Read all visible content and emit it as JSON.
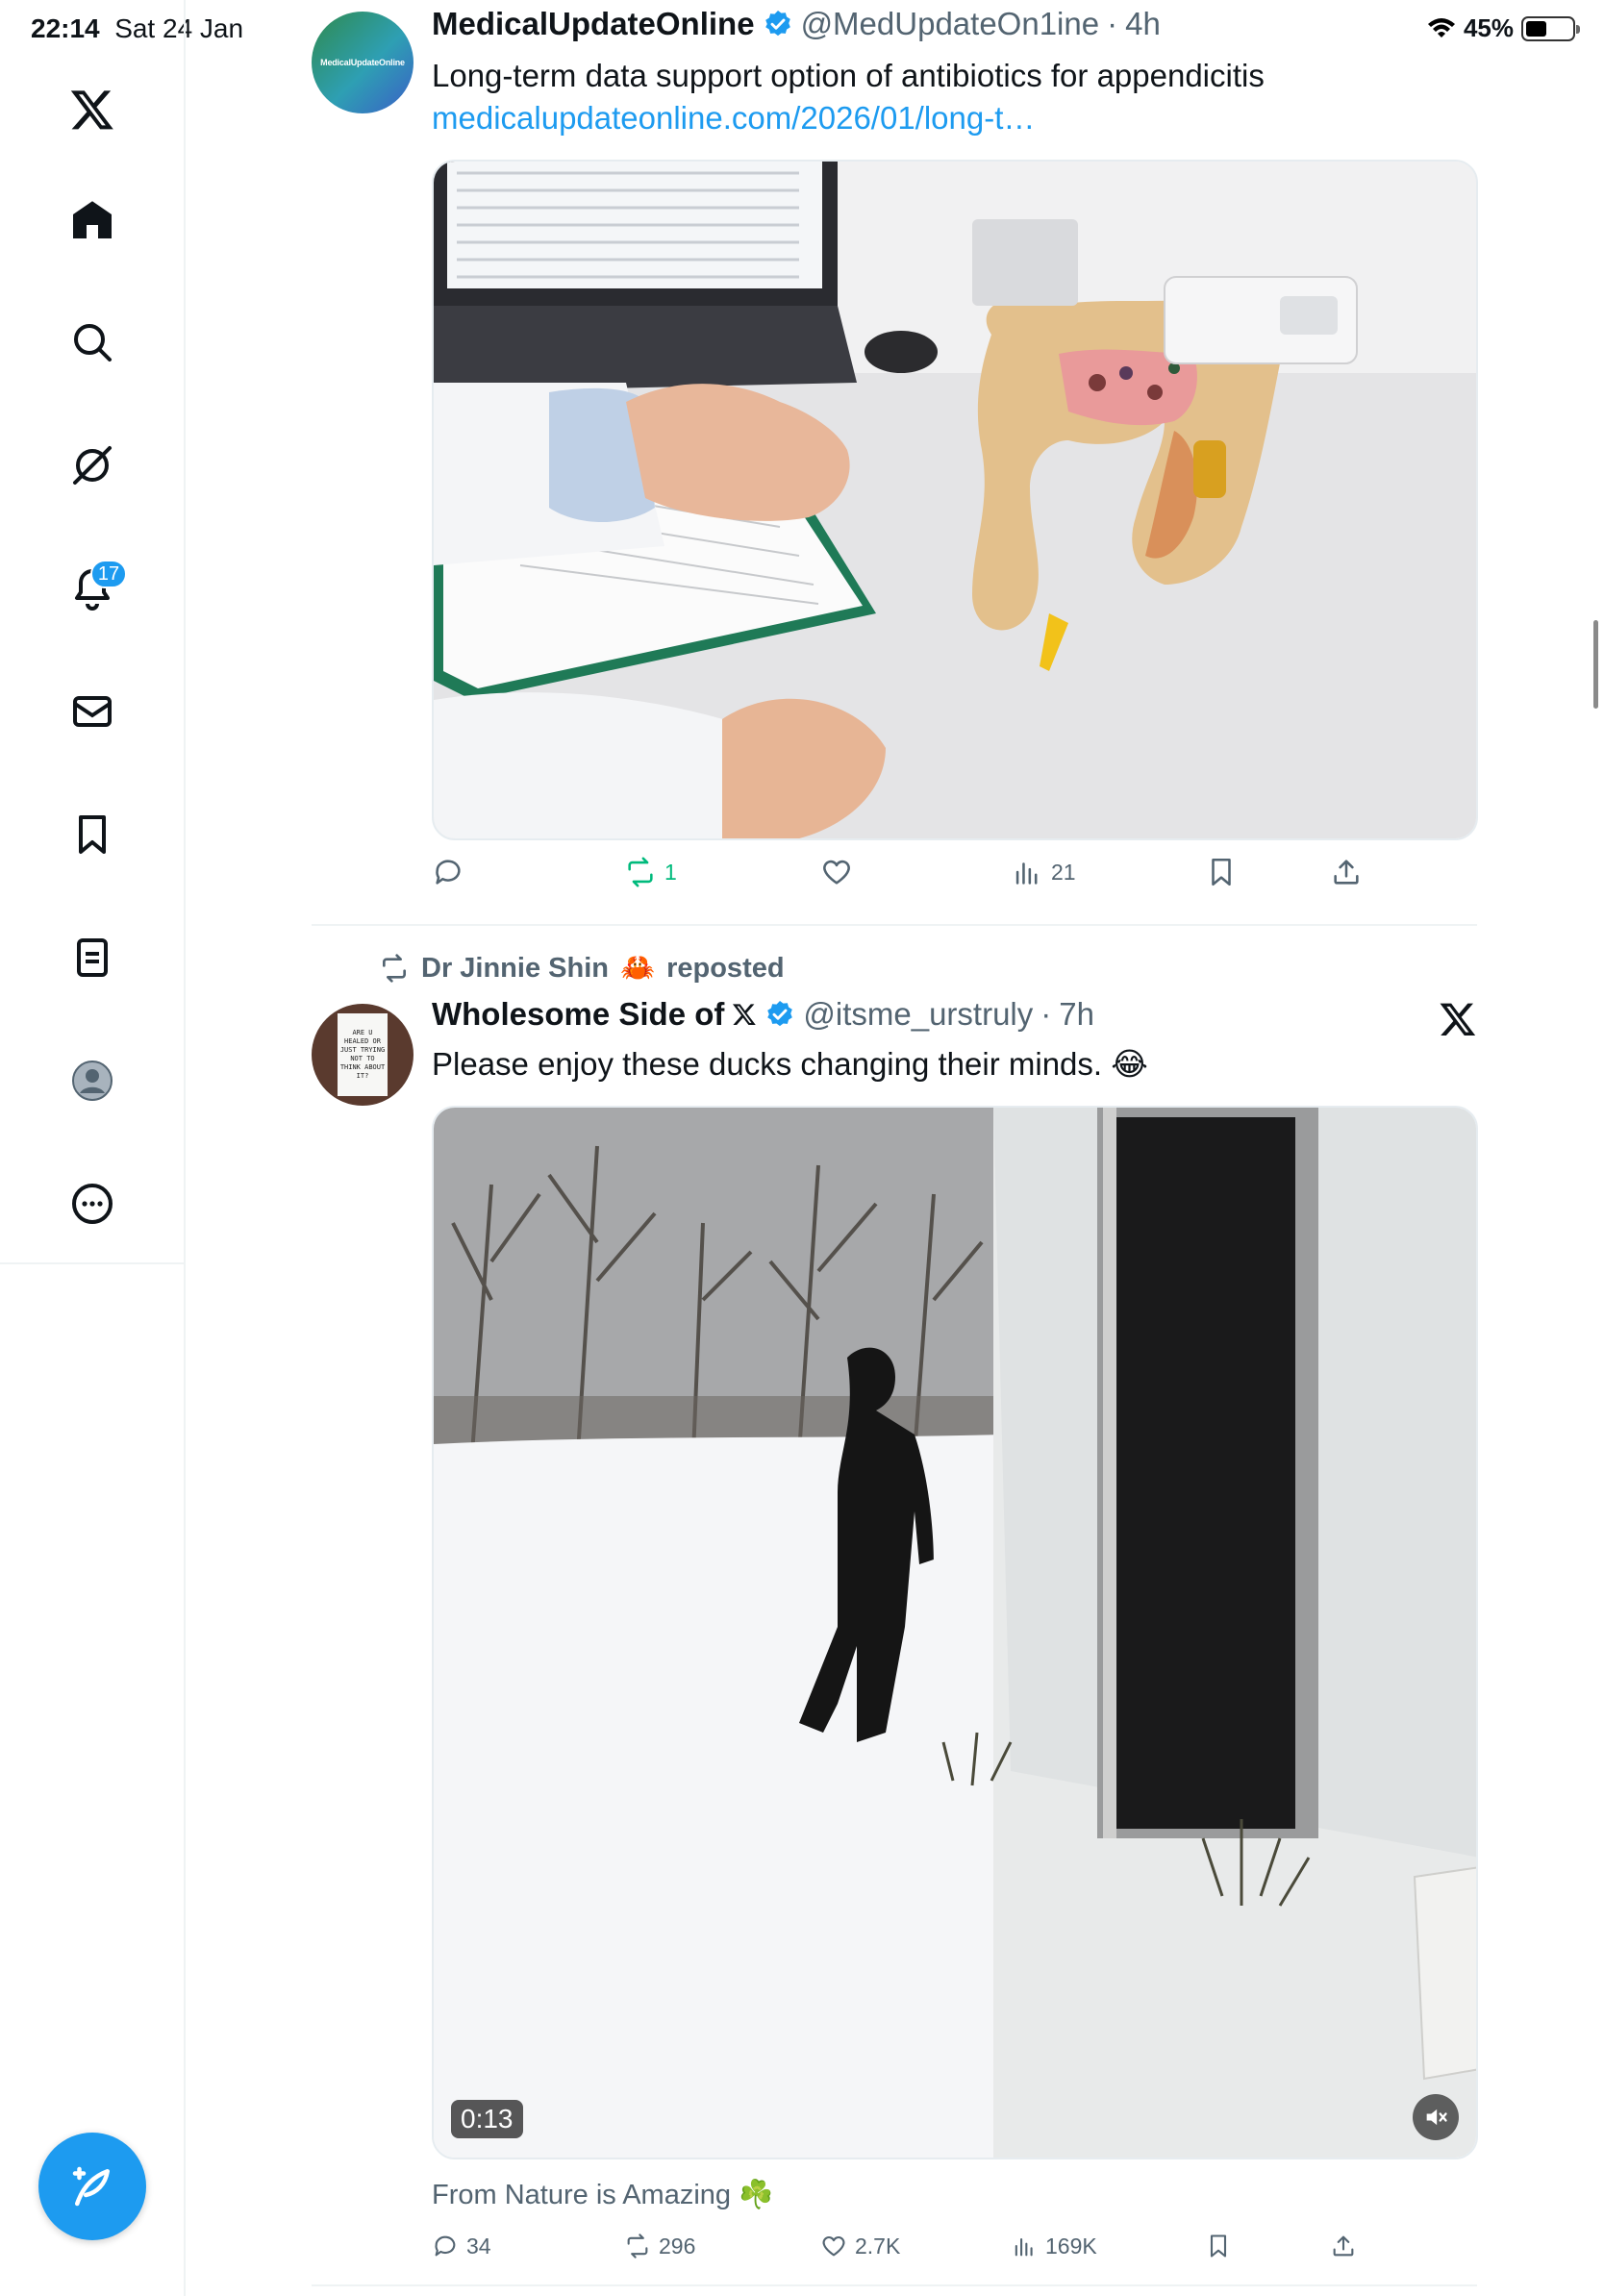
{
  "status_bar": {
    "time": "22:14",
    "date": "Sat 24 Jan",
    "battery": "45%"
  },
  "sidebar": {
    "notifications_badge": "17",
    "items": [
      "x-logo",
      "home-icon",
      "search-icon",
      "grok-icon",
      "notifications-icon",
      "messages-icon",
      "bookmarks-icon",
      "lists-icon",
      "profile-icon",
      "more-icon"
    ]
  },
  "tweets": [
    {
      "display_name": "MedicalUpdateOnline",
      "handle": "@MedUpdateOn1ine",
      "time": "4h",
      "avatar_text": "MedicalUpdateOnline",
      "text": "Long-term data support option of antibiotics for appendicitis",
      "link": "medicalupdateonline.com/2026/01/long-t…",
      "stats": {
        "replies": "",
        "reposts": "1",
        "likes": "",
        "views": "21"
      }
    },
    {
      "repost_by": "Dr Jinnie Shin",
      "repost_emoji": "🦀",
      "repost_label": "reposted",
      "display_name": "Wholesome Side of",
      "handle": "@itsme_urstruly",
      "time": "7h",
      "avatar_text": "ARE U HEALED OR JUST TRYING NOT TO THINK ABOUT IT?",
      "text": "Please enjoy these ducks changing their minds. 😂",
      "video_duration": "0:13",
      "source": "From Nature is Amazing ☘️",
      "stats": {
        "replies": "34",
        "reposts": "296",
        "likes": "2.7K",
        "views": "169K"
      }
    }
  ],
  "colors": {
    "accent": "#1d9bf0",
    "repost_green": "#00ba7c",
    "secondary_text": "#536471"
  }
}
